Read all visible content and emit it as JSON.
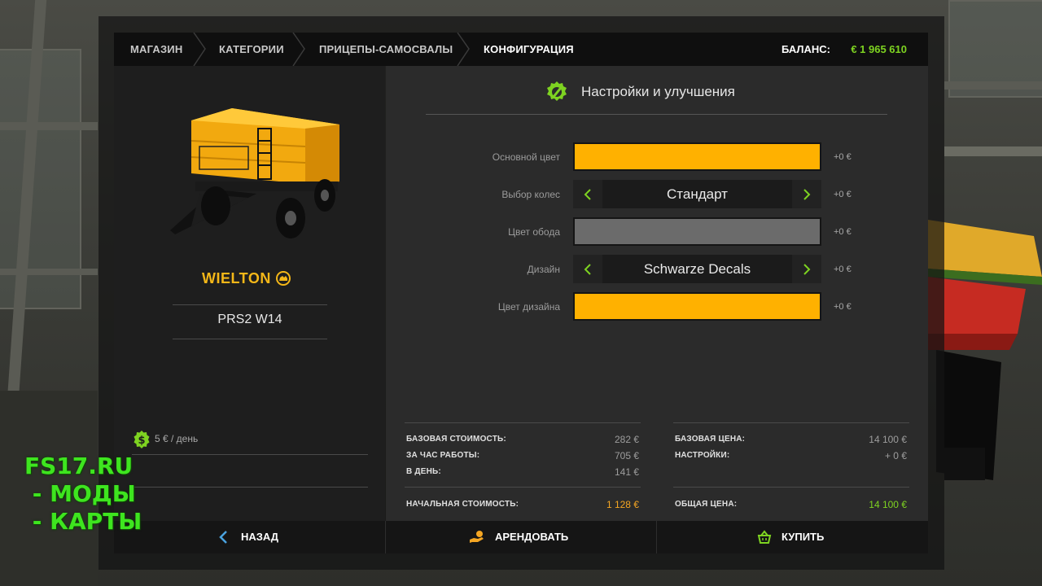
{
  "breadcrumb": [
    {
      "label": "МАГАЗИН"
    },
    {
      "label": "КАТЕГОРИИ"
    },
    {
      "label": "ПРИЦЕПЫ-САМОСВАЛЫ"
    },
    {
      "label": "КОНФИГУРАЦИЯ"
    }
  ],
  "balance": {
    "label": "БАЛАНС:",
    "value": "€ 1 965 610"
  },
  "product": {
    "brand": "WIELTON",
    "model": "PRS2 W14",
    "daily_cost": "5 € / день"
  },
  "section": {
    "title": "Настройки и улучшения",
    "icon": "gear-wrench-icon"
  },
  "config": {
    "base_color": {
      "label": "Основной цвет",
      "color": "#ffb100",
      "price": "+0 €"
    },
    "wheels": {
      "label": "Выбор колес",
      "value": "Стандарт",
      "price": "+0 €"
    },
    "rim_color": {
      "label": "Цвет обода",
      "color": "#6b6b6b",
      "price": "+0 €"
    },
    "design": {
      "label": "Дизайн",
      "value": "Schwarze Decals",
      "price": "+0 €"
    },
    "design_color": {
      "label": "Цвет дизайна",
      "color": "#ffb100",
      "price": "+0 €"
    }
  },
  "costs": {
    "base_cost": {
      "label": "БАЗОВАЯ СТОИМОСТЬ:",
      "value": "282 €"
    },
    "per_hour": {
      "label": "ЗА ЧАС РАБОТЫ:",
      "value": "705 €"
    },
    "per_day": {
      "label": "В ДЕНЬ:",
      "value": "141 €"
    },
    "initial_cost": {
      "label": "НАЧАЛЬНАЯ СТОИМОСТЬ:",
      "value": "1 128 €"
    },
    "base_price": {
      "label": "БАЗОВАЯ ЦЕНА:",
      "value": "14 100 €"
    },
    "settings": {
      "label": "НАСТРОЙКИ:",
      "value": "+ 0 €"
    },
    "total_price": {
      "label": "ОБЩАЯ ЦЕНА:",
      "value": "14 100 €"
    }
  },
  "actions": {
    "back": "НАЗАД",
    "lease": "АРЕНДОВАТЬ",
    "buy": "КУПИТЬ"
  },
  "watermark": [
    "FS17.RU",
    " - МОДЫ",
    " - КАРТЫ"
  ],
  "colors": {
    "accent_green": "#7ed321",
    "accent_orange": "#f5a623",
    "trailer_yellow": "#ffb100",
    "back_arrow_blue": "#4aa3df"
  }
}
